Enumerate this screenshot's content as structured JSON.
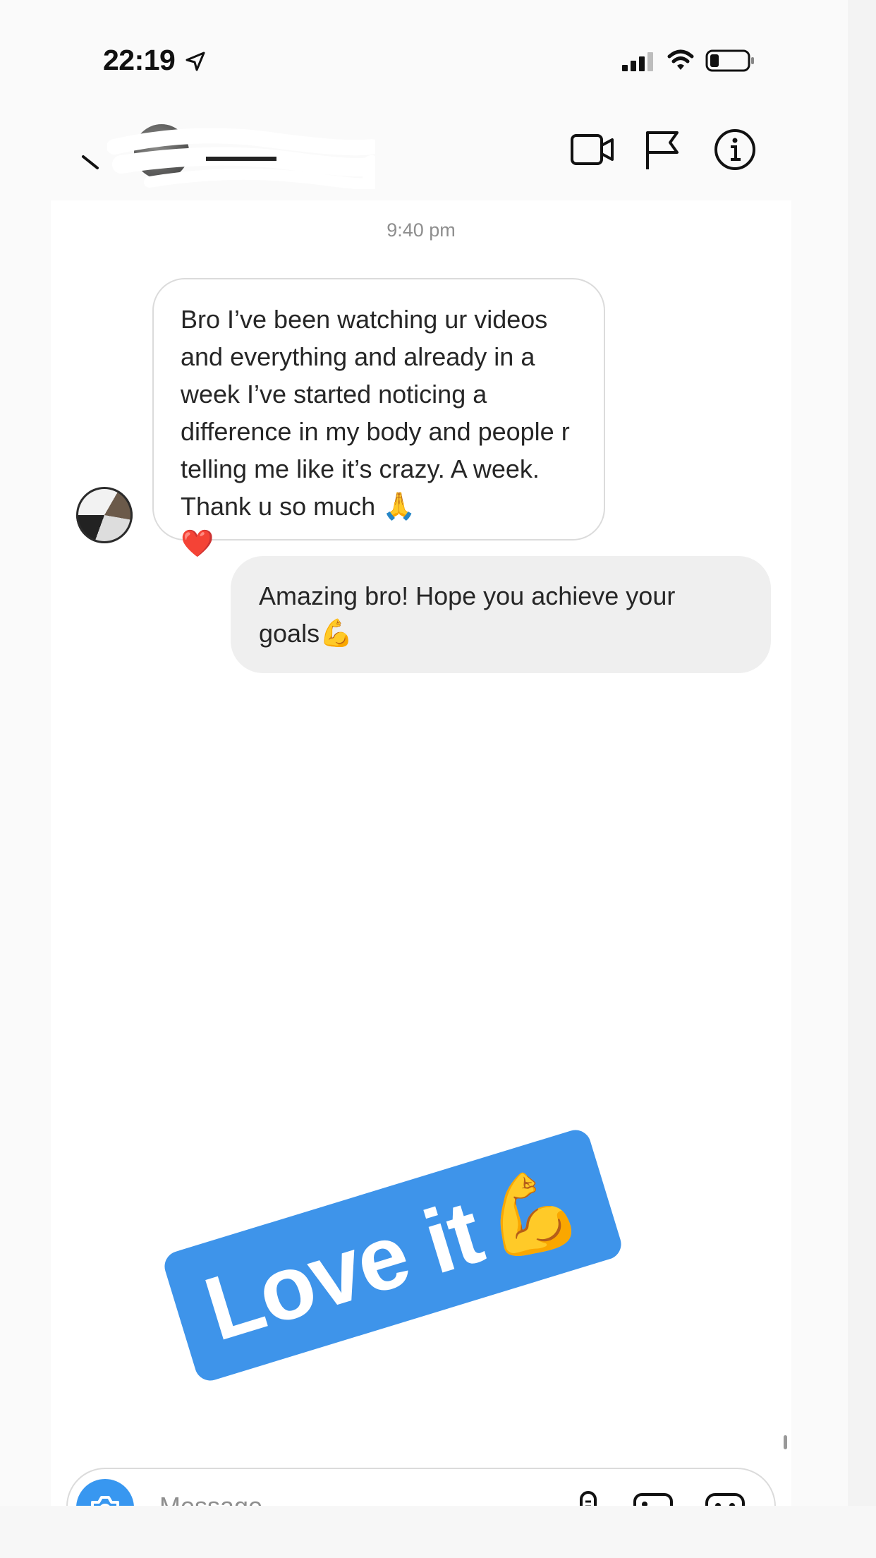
{
  "status_bar": {
    "time": "22:19",
    "location_icon": "location-arrow-icon",
    "signal_icon": "cellular-signal-icon",
    "wifi_icon": "wifi-icon",
    "battery_icon": "battery-icon"
  },
  "header": {
    "back_icon": "back-chevron-icon",
    "video_icon": "video-call-icon",
    "flag_icon": "flag-icon",
    "info_icon": "info-icon"
  },
  "chat": {
    "timestamp": "9:40 pm",
    "messages": [
      {
        "from": "them",
        "text": "Bro I’ve been watching ur videos and everything and already in a week I’ve started noticing a difference in my body and people r telling me like it’s crazy. A week. Thank u so much",
        "emoji_1": "🙏",
        "emoji_2": "❤️"
      },
      {
        "from": "me",
        "text": "Amazing bro! Hope you achieve your goals",
        "emoji": "💪"
      }
    ],
    "sticker": {
      "text": "Love it",
      "emoji": "💪",
      "color": "#3e94ea"
    }
  },
  "composer": {
    "placeholder": "Message",
    "camera_icon": "camera-icon",
    "mic_icon": "microphone-icon",
    "gallery_icon": "gallery-icon",
    "sticker_icon": "sticker-icon",
    "accent": "#3897f0"
  }
}
